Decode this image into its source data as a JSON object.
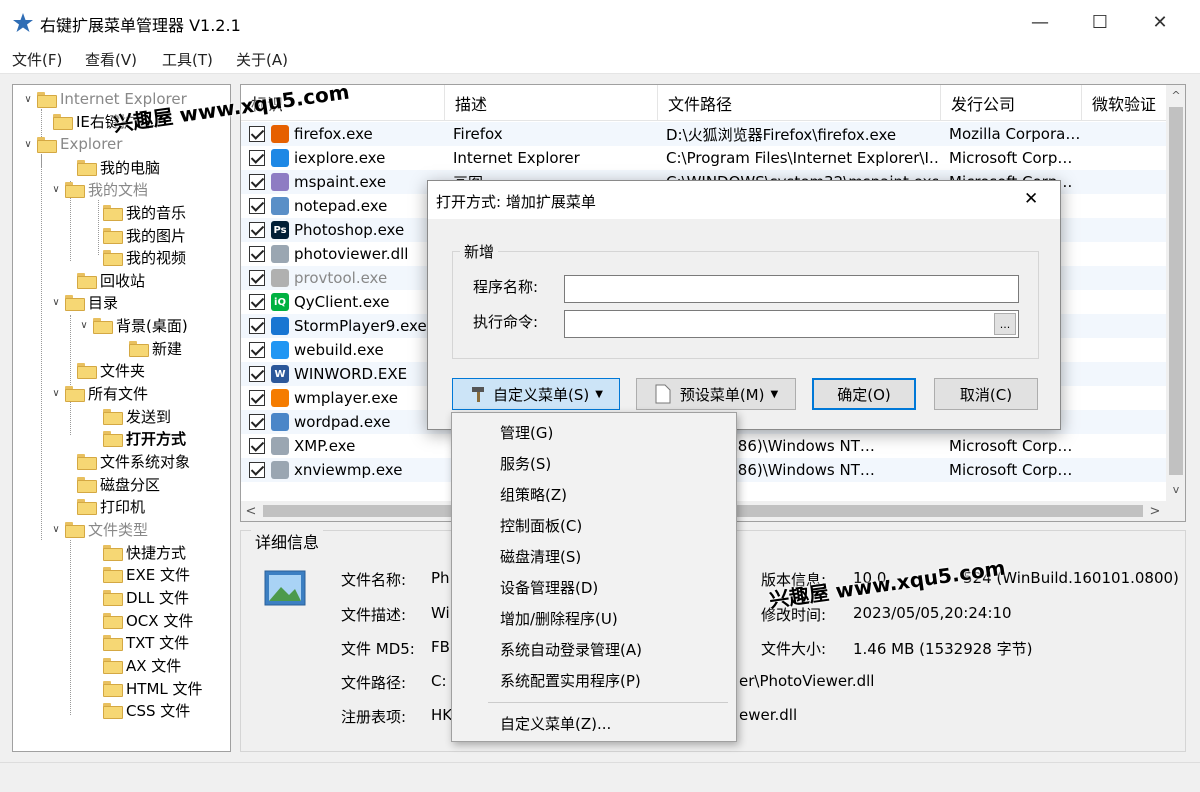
{
  "window": {
    "title": "右键扩展菜单管理器 V1.2.1",
    "minimize": "—",
    "maximize": "☐",
    "close": "✕"
  },
  "menubar": {
    "items": [
      "文件(F)",
      "查看(V)",
      "工具(T)",
      "关于(A)"
    ]
  },
  "tree": {
    "nodes": [
      {
        "label": "Internet Explorer",
        "gray": true
      },
      {
        "label": "IE右键扩展"
      },
      {
        "label": "Explorer",
        "gray": true
      },
      {
        "label": "我的电脑"
      },
      {
        "label": "我的文档",
        "gray": true
      },
      {
        "label": "我的音乐"
      },
      {
        "label": "我的图片"
      },
      {
        "label": "我的视频"
      },
      {
        "label": "回收站"
      },
      {
        "label": "目录"
      },
      {
        "label": "背景(桌面)"
      },
      {
        "label": "新建"
      },
      {
        "label": "文件夹"
      },
      {
        "label": "所有文件"
      },
      {
        "label": "发送到"
      },
      {
        "label": "打开方式",
        "bold": true
      },
      {
        "label": "文件系统对象"
      },
      {
        "label": "磁盘分区"
      },
      {
        "label": "打印机"
      },
      {
        "label": "文件类型",
        "gray": true
      },
      {
        "label": "快捷方式"
      },
      {
        "label": "EXE 文件"
      },
      {
        "label": "DLL 文件"
      },
      {
        "label": "OCX 文件"
      },
      {
        "label": "TXT 文件"
      },
      {
        "label": "AX 文件"
      },
      {
        "label": "HTML 文件"
      },
      {
        "label": "CSS 文件"
      }
    ]
  },
  "list": {
    "columns": [
      "标识",
      "描述",
      "文件路径",
      "发行公司",
      "微软验证"
    ],
    "rows": [
      {
        "name": "firefox.exe",
        "desc": "Firefox",
        "path": "D:\\火狐浏览器Firefox\\firefox.exe",
        "company": "Mozilla Corpora…",
        "icon_color": "#e66000"
      },
      {
        "name": "iexplore.exe",
        "desc": "Internet Explorer",
        "path": "C:\\Program Files\\Internet Explorer\\I…",
        "company": "Microsoft Corp…",
        "icon_color": "#1e88e5"
      },
      {
        "name": "mspaint.exe",
        "desc": "画图",
        "path": "C:\\WINDOWS\\system32\\mspaint.exe",
        "company": "Microsoft Corp…",
        "icon_color": "#8e7cc3"
      },
      {
        "name": "notepad.exe",
        "desc": "",
        "path": "",
        "company": "",
        "icon_color": "#5a8fc7"
      },
      {
        "name": "Photoshop.exe",
        "desc": "",
        "path": "",
        "company": "",
        "icon_color": "#001e36"
      },
      {
        "name": "photoviewer.dll",
        "desc": "",
        "path": "",
        "company": "",
        "icon_color": "#9aa6b2"
      },
      {
        "name": "provtool.exe",
        "desc": "",
        "path": "",
        "company": "",
        "icon_color": "#b0b0b0",
        "gray": true
      },
      {
        "name": "QyClient.exe",
        "desc": "",
        "path": "",
        "company": "",
        "icon_color": "#00b140"
      },
      {
        "name": "StormPlayer9.exe",
        "desc": "",
        "path": "",
        "company": "",
        "icon_color": "#1976d2"
      },
      {
        "name": "webuild.exe",
        "desc": "",
        "path": "",
        "company": "",
        "icon_color": "#2196f3"
      },
      {
        "name": "WINWORD.EXE",
        "desc": "",
        "path": "",
        "company": "",
        "icon_color": "#2b579a"
      },
      {
        "name": "wmplayer.exe",
        "desc": "",
        "path": "",
        "company": "",
        "icon_color": "#f57c00"
      },
      {
        "name": "wordpad.exe",
        "desc": "",
        "path": "",
        "company": "",
        "icon_color": "#4a86c8"
      },
      {
        "name": "XMP.exe",
        "desc": "",
        "path": "m Files (x86)\\Windows NT…",
        "company": "Microsoft Corp…",
        "icon_color": "#9aa6b2"
      },
      {
        "name": "xnviewmp.exe",
        "desc": "",
        "path": "m Files (x86)\\Windows NT…",
        "company": "Microsoft Corp…",
        "icon_color": "#9aa6b2"
      }
    ],
    "scroll_left": "<",
    "scroll_right": ">",
    "scroll_up": "^",
    "scroll_down": "v"
  },
  "details": {
    "legend": "详细信息",
    "file_name_label": "文件名称:",
    "file_name_value": "Ph",
    "file_desc_label": "文件描述:",
    "file_desc_value": "Wi",
    "file_md5_label": "文件 MD5:",
    "file_md5_value": "FB",
    "file_path_label": "文件路径:",
    "file_path_value": "C:",
    "file_path_tail": "er\\PhotoViewer.dll",
    "reg_label": "注册表项:",
    "reg_value": "HK",
    "reg_tail": "ewer.dll",
    "version_label": "版本信息:",
    "version_value": "10.0.",
    "version_tail": "524 (WinBuild.160101.0800)",
    "time_label": "修改时间:",
    "time_value": "2023/05/05,20:24:10",
    "size_label": "文件大小:",
    "size_value": "1.46 MB (1532928 字节)"
  },
  "dialog": {
    "title": "打开方式: 增加扩展菜单",
    "close": "✕",
    "group_label": "新增",
    "program_label": "程序名称:",
    "program_value": "",
    "command_label": "执行命令:",
    "command_value": "",
    "browse_label": "...",
    "custom_menu_btn": "自定义菜单(S)",
    "preset_menu_btn": "预设菜单(M)",
    "ok_btn": "确定(O)",
    "cancel_btn": "取消(C)"
  },
  "popup": {
    "items": [
      "管理(G)",
      "服务(S)",
      "组策略(Z)",
      "控制面板(C)",
      "磁盘清理(S)",
      "设备管理器(D)",
      "增加/删除程序(U)",
      "系统自动登录管理(A)",
      "系统配置实用程序(P)"
    ],
    "last_item": "自定义菜单(Z)..."
  },
  "watermarks": {
    "top": "兴趣屋 www.xqu5.com",
    "bottom": "兴趣屋 www.xqu5.com"
  },
  "colors": {
    "accent": "#0078d7",
    "row_alt": "#f2f7fd",
    "folder": "#f6d774"
  }
}
